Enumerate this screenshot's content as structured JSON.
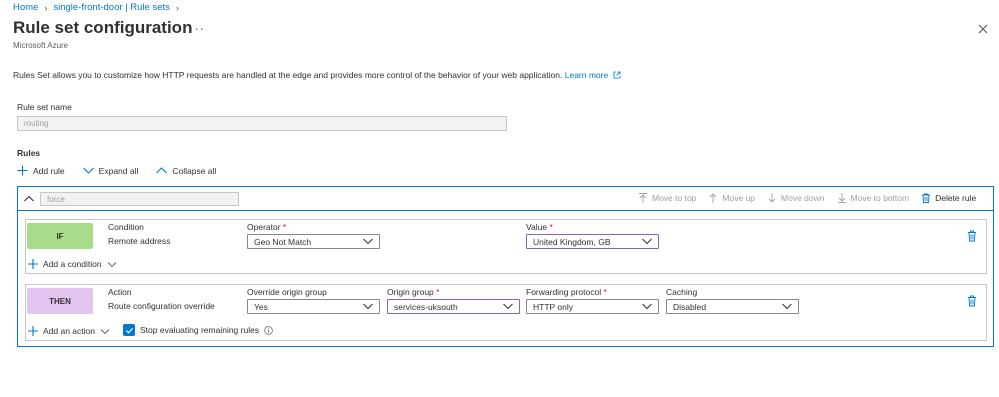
{
  "breadcrumb": {
    "home": "Home",
    "resource": "single-front-door | Rule sets"
  },
  "header": {
    "title": "Rule set configuration",
    "more": "···",
    "subtitle": "Microsoft Azure"
  },
  "description": {
    "text": "Rules Set allows you to customize how HTTP requests are handled at the edge and provides more control of the behavior of your web application.",
    "learn_more": "Learn more"
  },
  "rule_set_name": {
    "label": "Rule set name",
    "value": "routing"
  },
  "rules": {
    "heading": "Rules",
    "toolbar": {
      "add_rule": "Add rule",
      "expand_all": "Expand all",
      "collapse_all": "Collapse all"
    }
  },
  "rule": {
    "name": "force",
    "actions": {
      "move_top": "Move to top",
      "move_up": "Move up",
      "move_down": "Move down",
      "move_bottom": "Move to bottom",
      "delete": "Delete rule"
    },
    "condition": {
      "badge": "IF",
      "badge_color": "#a8dc8a",
      "type_label": "Condition",
      "type_value": "Remote address",
      "operator_label": "Operator",
      "operator_value": "Geo Not Match",
      "value_label": "Value",
      "value_value": "United Kingdom, GB",
      "add_condition": "Add a condition"
    },
    "action": {
      "badge": "THEN",
      "badge_color": "#e2c4ef",
      "type_label": "Action",
      "type_value": "Route configuration override",
      "override_label": "Override origin group",
      "override_value": "Yes",
      "origin_label": "Origin group",
      "origin_value": "services-uksouth",
      "protocol_label": "Forwarding protocol",
      "protocol_value": "HTTP only",
      "caching_label": "Caching",
      "caching_value": "Disabled",
      "add_action": "Add an action",
      "stop_evaluating": "Stop evaluating remaining rules"
    }
  },
  "required_mark": "*",
  "icons": [
    "chevron-right-icon",
    "ellipsis-icon",
    "close-icon",
    "external-link-icon",
    "plus-icon",
    "chevron-down-icon",
    "chevron-up-icon",
    "arrow-up-to-top-icon",
    "arrow-up-icon",
    "arrow-down-icon",
    "arrow-down-to-bottom-icon",
    "trash-icon",
    "checkmark-icon",
    "info-icon"
  ]
}
